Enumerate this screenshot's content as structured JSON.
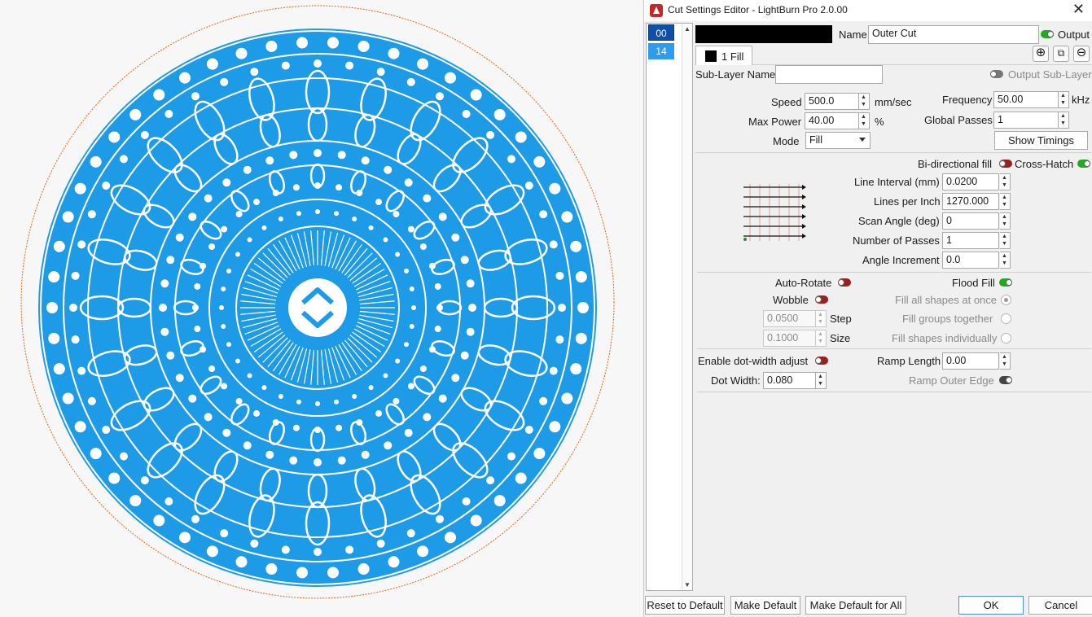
{
  "window": {
    "title": "Cut Settings Editor - LightBurn Pro 2.0.00",
    "close_glyph": "✕"
  },
  "layers": [
    {
      "label": "00",
      "color": "#0e4fa8",
      "selected": true
    },
    {
      "label": "14",
      "color": "#2d9bf0",
      "selected": false
    }
  ],
  "header": {
    "layer_color": "#000000",
    "name_label": "Name",
    "name_value": "Outer Cut",
    "output_label": "Output",
    "output_on": true
  },
  "tabs": [
    {
      "label": "1 Fill",
      "swatch": "#000000"
    }
  ],
  "tab_actions": {
    "add": "⊕",
    "copy": "⧉",
    "remove": "⊖"
  },
  "sublayer": {
    "name_label": "Sub-Layer Name",
    "name_value": "",
    "output_label": "Output Sub-Layer",
    "output_on": false
  },
  "settings": {
    "speed_label": "Speed",
    "speed_value": "500.0",
    "speed_unit": "mm/sec",
    "maxpower_label": "Max Power",
    "maxpower_value": "40.00",
    "maxpower_unit": "%",
    "mode_label": "Mode",
    "mode_value": "Fill",
    "frequency_label": "Frequency",
    "frequency_value": "50.00",
    "frequency_unit": "kHz",
    "passes_label": "Global Passes",
    "passes_value": "1",
    "show_timings": "Show Timings"
  },
  "fill": {
    "bidirectional_label": "Bi-directional fill",
    "bidirectional_on": false,
    "crosshatch_label": "Cross-Hatch",
    "crosshatch_on": true,
    "line_interval_label": "Line Interval (mm)",
    "line_interval_value": "0.0200",
    "lpi_label": "Lines per Inch",
    "lpi_value": "1270.000",
    "scan_angle_label": "Scan Angle (deg)",
    "scan_angle_value": "0",
    "num_passes_label": "Number of Passes",
    "num_passes_value": "1",
    "angle_inc_label": "Angle Increment",
    "angle_inc_value": "0.0"
  },
  "options": {
    "auto_rotate_label": "Auto-Rotate",
    "auto_rotate_on": false,
    "wobble_label": "Wobble",
    "wobble_on": false,
    "step_value": "0.0500",
    "step_label": "Step",
    "size_value": "0.1000",
    "size_label": "Size",
    "flood_fill_label": "Flood Fill",
    "flood_fill_on": true,
    "fill_all_label": "Fill all shapes at once",
    "fill_groups_label": "Fill groups together",
    "fill_individual_label": "Fill shapes individually"
  },
  "dots": {
    "dot_adjust_label": "Enable dot-width adjust",
    "dot_adjust_on": false,
    "dot_width_label": "Dot Width:",
    "dot_width_value": "0.080",
    "ramp_length_label": "Ramp Length",
    "ramp_length_value": "0.00",
    "ramp_outer_label": "Ramp Outer Edge"
  },
  "footer": {
    "reset": "Reset to Default",
    "make_default": "Make Default",
    "make_default_all": "Make Default for All",
    "ok": "OK",
    "cancel": "Cancel"
  },
  "colors": {
    "mandala_blue": "#1e9be6",
    "outline_orange": "#e0661b"
  }
}
